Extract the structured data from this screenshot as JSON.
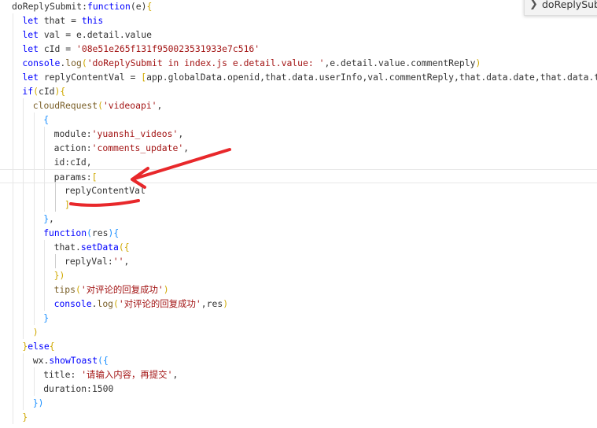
{
  "theme": {
    "keyword": "#0000ff",
    "string": "#a31515",
    "plain": "#333333",
    "function": "#795e26",
    "bracket_yellow": "#cfa800",
    "bracket_blue": "#1a8fff",
    "annotation": "#e8282b"
  },
  "find_widget": {
    "icon": "chevron-right-icon",
    "text": "doReplySubmi"
  },
  "code_lines": [
    {
      "indent": 0,
      "tokens": [
        {
          "t": "doReplySubmit",
          "c": "plain"
        },
        {
          "t": ":",
          "c": "plain"
        },
        {
          "t": "function",
          "c": "keyword"
        },
        {
          "t": "(e)",
          "c": "plain"
        },
        {
          "t": "{",
          "c": "bracket_yellow"
        }
      ]
    },
    {
      "indent": 1,
      "tokens": [
        {
          "t": "let",
          "c": "keyword"
        },
        {
          "t": " that = ",
          "c": "plain"
        },
        {
          "t": "this",
          "c": "keyword"
        }
      ]
    },
    {
      "indent": 1,
      "tokens": [
        {
          "t": "let",
          "c": "keyword"
        },
        {
          "t": " val = e.detail.value",
          "c": "plain"
        }
      ]
    },
    {
      "indent": 1,
      "tokens": [
        {
          "t": "let",
          "c": "keyword"
        },
        {
          "t": " cId = ",
          "c": "plain"
        },
        {
          "t": "'08e51e265f131f950023531933e7c516'",
          "c": "string"
        }
      ]
    },
    {
      "indent": 1,
      "tokens": [
        {
          "t": "console",
          "c": "keyword"
        },
        {
          "t": ".",
          "c": "plain"
        },
        {
          "t": "log",
          "c": "function"
        },
        {
          "t": "(",
          "c": "bracket_yellow"
        },
        {
          "t": "'doReplySubmit in index.js e.detail.value: '",
          "c": "string"
        },
        {
          "t": ",e.detail.value.commentReply",
          "c": "plain"
        },
        {
          "t": ")",
          "c": "bracket_yellow"
        }
      ]
    },
    {
      "indent": 1,
      "tokens": [
        {
          "t": "let",
          "c": "keyword"
        },
        {
          "t": " replyContentVal = ",
          "c": "plain"
        },
        {
          "t": "[",
          "c": "bracket_yellow"
        },
        {
          "t": "app.globalData.openid,that.data.userInfo,val.commentReply,that.data.date,that.data.time",
          "c": "plain"
        },
        {
          "t": "]",
          "c": "bracket_yellow"
        }
      ]
    },
    {
      "indent": 1,
      "tokens": [
        {
          "t": "if",
          "c": "keyword"
        },
        {
          "t": "(",
          "c": "bracket_yellow"
        },
        {
          "t": "cId",
          "c": "plain"
        },
        {
          "t": ")",
          "c": "bracket_yellow"
        },
        {
          "t": "{",
          "c": "bracket_yellow"
        }
      ]
    },
    {
      "indent": 2,
      "tokens": [
        {
          "t": "cloudRequest",
          "c": "function"
        },
        {
          "t": "(",
          "c": "bracket_yellow"
        },
        {
          "t": "'videoapi'",
          "c": "string"
        },
        {
          "t": ",",
          "c": "plain"
        }
      ]
    },
    {
      "indent": 3,
      "tokens": [
        {
          "t": "{",
          "c": "bracket_blue"
        }
      ]
    },
    {
      "indent": 4,
      "tokens": [
        {
          "t": "module:",
          "c": "plain"
        },
        {
          "t": "'yuanshi_videos'",
          "c": "string"
        },
        {
          "t": ",",
          "c": "plain"
        }
      ]
    },
    {
      "indent": 4,
      "tokens": [
        {
          "t": "action:",
          "c": "plain"
        },
        {
          "t": "'comments_update'",
          "c": "string"
        },
        {
          "t": ",",
          "c": "plain"
        }
      ]
    },
    {
      "indent": 4,
      "tokens": [
        {
          "t": "id:cId,",
          "c": "plain"
        }
      ]
    },
    {
      "indent": 4,
      "tokens": [
        {
          "t": "params:",
          "c": "plain"
        },
        {
          "t": "[",
          "c": "bracket_yellow"
        }
      ]
    },
    {
      "indent": 5,
      "tokens": [
        {
          "t": "replyContentVal",
          "c": "plain"
        }
      ]
    },
    {
      "indent": 5,
      "tokens": [
        {
          "t": "]",
          "c": "bracket_yellow"
        }
      ]
    },
    {
      "indent": 3,
      "tokens": [
        {
          "t": "}",
          "c": "bracket_blue"
        },
        {
          "t": ",",
          "c": "plain"
        }
      ]
    },
    {
      "indent": 3,
      "tokens": [
        {
          "t": "function",
          "c": "keyword"
        },
        {
          "t": "(",
          "c": "bracket_blue"
        },
        {
          "t": "res",
          "c": "plain"
        },
        {
          "t": ")",
          "c": "bracket_blue"
        },
        {
          "t": "{",
          "c": "bracket_blue"
        }
      ]
    },
    {
      "indent": 4,
      "tokens": [
        {
          "t": "that.",
          "c": "plain"
        },
        {
          "t": "setData",
          "c": "keyword"
        },
        {
          "t": "(",
          "c": "bracket_yellow"
        },
        {
          "t": "{",
          "c": "bracket_yellow"
        }
      ]
    },
    {
      "indent": 5,
      "tokens": [
        {
          "t": "replyVal:",
          "c": "plain"
        },
        {
          "t": "''",
          "c": "string"
        },
        {
          "t": ",",
          "c": "plain"
        }
      ]
    },
    {
      "indent": 4,
      "tokens": [
        {
          "t": "}",
          "c": "bracket_yellow"
        },
        {
          "t": ")",
          "c": "bracket_yellow"
        }
      ]
    },
    {
      "indent": 4,
      "tokens": [
        {
          "t": "tips",
          "c": "function"
        },
        {
          "t": "(",
          "c": "bracket_yellow"
        },
        {
          "t": "'对评论的回复成功'",
          "c": "string"
        },
        {
          "t": ")",
          "c": "bracket_yellow"
        }
      ]
    },
    {
      "indent": 4,
      "tokens": [
        {
          "t": "console",
          "c": "keyword"
        },
        {
          "t": ".",
          "c": "plain"
        },
        {
          "t": "log",
          "c": "function"
        },
        {
          "t": "(",
          "c": "bracket_yellow"
        },
        {
          "t": "'对评论的回复成功'",
          "c": "string"
        },
        {
          "t": ",res",
          "c": "plain"
        },
        {
          "t": ")",
          "c": "bracket_yellow"
        }
      ]
    },
    {
      "indent": 3,
      "tokens": [
        {
          "t": "}",
          "c": "bracket_blue"
        }
      ]
    },
    {
      "indent": 2,
      "tokens": [
        {
          "t": ")",
          "c": "bracket_yellow"
        }
      ]
    },
    {
      "indent": 1,
      "tokens": [
        {
          "t": "}",
          "c": "bracket_yellow"
        },
        {
          "t": "else",
          "c": "keyword"
        },
        {
          "t": "{",
          "c": "bracket_yellow"
        }
      ]
    },
    {
      "indent": 2,
      "tokens": [
        {
          "t": "wx.",
          "c": "plain"
        },
        {
          "t": "showToast",
          "c": "keyword"
        },
        {
          "t": "(",
          "c": "bracket_blue"
        },
        {
          "t": "{",
          "c": "bracket_blue"
        }
      ]
    },
    {
      "indent": 3,
      "tokens": [
        {
          "t": "title: ",
          "c": "plain"
        },
        {
          "t": "'请输入内容，再提交'",
          "c": "string"
        },
        {
          "t": ",",
          "c": "plain"
        }
      ]
    },
    {
      "indent": 3,
      "tokens": [
        {
          "t": "duration:1500",
          "c": "plain"
        }
      ]
    },
    {
      "indent": 2,
      "tokens": [
        {
          "t": "}",
          "c": "bracket_blue"
        },
        {
          "t": ")",
          "c": "bracket_blue"
        }
      ]
    },
    {
      "indent": 1,
      "tokens": [
        {
          "t": "}",
          "c": "bracket_yellow"
        }
      ]
    }
  ]
}
